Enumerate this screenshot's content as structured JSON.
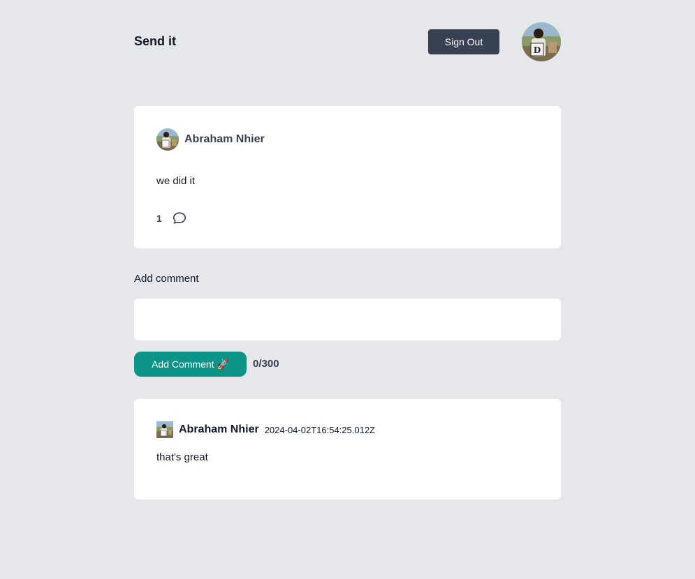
{
  "header": {
    "brand": "Send it",
    "sign_out_label": "Sign Out",
    "avatar_icon": "user-avatar-photo"
  },
  "post": {
    "author": "Abraham Nhier",
    "body": "we did it",
    "comment_count": "1",
    "comment_icon": "speech-bubble-icon"
  },
  "comment_form": {
    "label": "Add comment",
    "input_value": "",
    "input_placeholder": "",
    "submit_label": "Add Comment 🚀",
    "char_counter": "0/300"
  },
  "comments": [
    {
      "author": "Abraham Nhier",
      "timestamp": "2024-04-02T16:54:25.012Z",
      "body": "that's great"
    }
  ],
  "colors": {
    "background": "#e5e7eb",
    "sign_out_button": "#374151",
    "add_comment_button": "#0d9488",
    "card": "#ffffff"
  }
}
